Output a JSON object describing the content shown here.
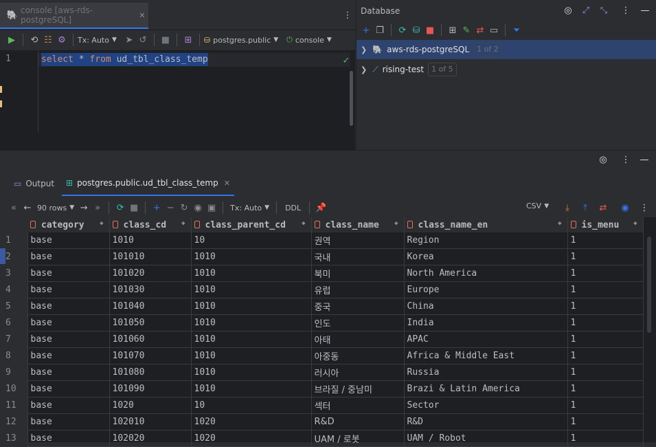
{
  "editor": {
    "tab_label": "console [aws-rds-postgreSQL]",
    "tx_label": "Tx: Auto",
    "schema_label": "postgres.public",
    "session_label": "console",
    "line_number": "1",
    "code": {
      "kw1": "select",
      "star": " * ",
      "kw2": "from",
      "ident": " ud_tbl_class_temp"
    }
  },
  "database": {
    "title": "Database",
    "items": [
      {
        "name": "aws-rds-postgreSQL",
        "badge": "1 of 2"
      },
      {
        "name": "rising-test",
        "badge": "1 of 5"
      }
    ]
  },
  "results": {
    "tabs": [
      {
        "label": "Output"
      },
      {
        "label": "postgres.public.ud_tbl_class_temp"
      }
    ],
    "rows_label": "90 rows",
    "tx_label": "Tx: Auto",
    "ddl_label": "DDL",
    "export_label": "CSV",
    "columns": [
      "category",
      "class_cd",
      "class_parent_cd",
      "class_name",
      "class_name_en",
      "is_menu"
    ],
    "rows": [
      [
        "1",
        "base",
        "1010",
        "10",
        "권역",
        "Region",
        "1"
      ],
      [
        "2",
        "base",
        "101010",
        "1010",
        "국내",
        "Korea",
        "1"
      ],
      [
        "3",
        "base",
        "101020",
        "1010",
        "북미",
        "North America",
        "1"
      ],
      [
        "4",
        "base",
        "101030",
        "1010",
        "유럽",
        "Europe",
        "1"
      ],
      [
        "5",
        "base",
        "101040",
        "1010",
        "중국",
        "China",
        "1"
      ],
      [
        "6",
        "base",
        "101050",
        "1010",
        "인도",
        "India",
        "1"
      ],
      [
        "7",
        "base",
        "101060",
        "1010",
        "아태",
        "APAC",
        "1"
      ],
      [
        "8",
        "base",
        "101070",
        "1010",
        "아중동",
        "Africa & Middle East",
        "1"
      ],
      [
        "9",
        "base",
        "101080",
        "1010",
        "러시아",
        "Russia",
        "1"
      ],
      [
        "10",
        "base",
        "101090",
        "1010",
        "브라질 / 중남미",
        "Brazi & Latin America",
        "1"
      ],
      [
        "11",
        "base",
        "1020",
        "10",
        "섹터",
        "Sector",
        "1"
      ],
      [
        "12",
        "base",
        "102010",
        "1020",
        "R&D",
        "R&D",
        "1"
      ],
      [
        "13",
        "base",
        "102020",
        "1020",
        "UAM / 로봇",
        "UAM / Robot",
        "1"
      ]
    ]
  },
  "colors": {
    "accent": "#3574f0",
    "run": "#5fb85b",
    "stop": "#e55757",
    "keyword": "#cf8e6d"
  }
}
